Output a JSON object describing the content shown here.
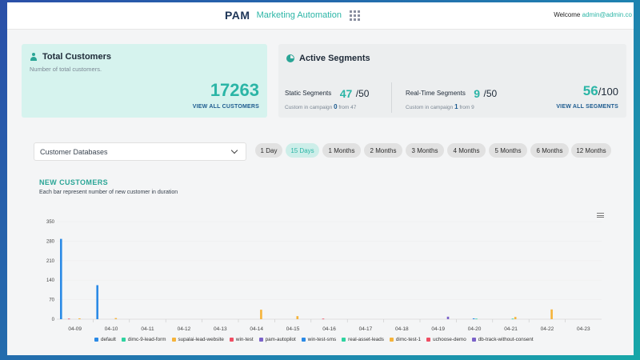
{
  "header": {
    "logo_text": "PAM",
    "app_title": "Marketing Automation",
    "welcome_label": "Welcome",
    "user_email": "admin@admin.co"
  },
  "customers_card": {
    "title": "Total Customers",
    "subtitle": "Number of total customers.",
    "total": "17263",
    "link": "VIEW ALL CUSTOMERS"
  },
  "segments_card": {
    "title": "Active Segments",
    "static_label": "Static Segments",
    "static_value": "47",
    "static_max": "/50",
    "static_note_prefix": "Custom in campaign",
    "static_note_count": "0",
    "static_note_suffix": "from 47",
    "realtime_label": "Real-Time Segments",
    "realtime_value": "9",
    "realtime_max": "/50",
    "realtime_note_prefix": "Custom in campaign",
    "realtime_note_count": "1",
    "realtime_note_suffix": "from 9",
    "total_value": "56",
    "total_max": "/100",
    "link": "VIEW ALL SEGMENTS"
  },
  "filters": {
    "database_select": "Customer Databases",
    "durations": [
      "1 Day",
      "15 Days",
      "1 Months",
      "2 Months",
      "3 Months",
      "4 Months",
      "5 Months",
      "6 Months",
      "12 Months"
    ],
    "active_duration": "15 Days"
  },
  "chart_section": {
    "title": "NEW CUSTOMERS",
    "subtitle": "Each bar represent number of new customer in duration"
  },
  "chart_data": {
    "type": "bar",
    "categories": [
      "04-09",
      "04-10",
      "04-11",
      "04-12",
      "04-13",
      "04-14",
      "04-15",
      "04-16",
      "04-17",
      "04-18",
      "04-19",
      "04-20",
      "04-21",
      "04-22",
      "04-23"
    ],
    "yticks": [
      0,
      70,
      140,
      210,
      280,
      350
    ],
    "ylim": [
      0,
      350
    ],
    "series": [
      {
        "name": "default",
        "color": "#2b8ae6",
        "values": [
          288,
          122,
          0,
          0,
          0,
          0,
          0,
          0,
          0,
          0,
          0,
          0,
          0,
          0,
          0
        ]
      },
      {
        "name": "dimc-9-lead-form",
        "color": "#2fd3a0",
        "values": [
          0,
          0,
          0,
          0,
          0,
          0,
          0,
          0,
          0,
          0,
          0,
          0,
          0,
          0,
          0
        ]
      },
      {
        "name": "supalai-lead-website",
        "color": "#f5b33a",
        "values": [
          0,
          0,
          0,
          0,
          0,
          0,
          0,
          0,
          0,
          0,
          0,
          0,
          0,
          0,
          0
        ]
      },
      {
        "name": "win-test",
        "color": "#ef4e63",
        "values": [
          2,
          0,
          0,
          0,
          0,
          0,
          0,
          2,
          0,
          0,
          0,
          0,
          0,
          0,
          0
        ]
      },
      {
        "name": "pam-autopilot",
        "color": "#7b62c9",
        "values": [
          0,
          0,
          0,
          0,
          0,
          0,
          0,
          0,
          0,
          0,
          0,
          0,
          0,
          0,
          0
        ]
      },
      {
        "name": "win-test-sms",
        "color": "#2b8ae6",
        "values": [
          0,
          0,
          0,
          0,
          0,
          0,
          0,
          0,
          0,
          0,
          0,
          3,
          0,
          0,
          0
        ]
      },
      {
        "name": "real-asset-leads",
        "color": "#2fd3a0",
        "values": [
          0,
          0,
          0,
          0,
          0,
          0,
          0,
          0,
          0,
          0,
          0,
          2,
          2,
          0,
          0
        ]
      },
      {
        "name": "dimc-test-1",
        "color": "#f5b33a",
        "values": [
          3,
          4,
          0,
          0,
          0,
          34,
          11,
          0,
          0,
          0,
          0,
          0,
          8,
          35,
          0
        ]
      },
      {
        "name": "uchoose-demo",
        "color": "#ef4e63",
        "values": [
          0,
          0,
          0,
          0,
          0,
          0,
          0,
          0,
          0,
          0,
          0,
          0,
          0,
          0,
          0
        ]
      },
      {
        "name": "db-track-without-consent",
        "color": "#7b62c9",
        "values": [
          0,
          0,
          0,
          0,
          0,
          0,
          0,
          0,
          0,
          0,
          9,
          0,
          0,
          0,
          0
        ]
      }
    ]
  }
}
